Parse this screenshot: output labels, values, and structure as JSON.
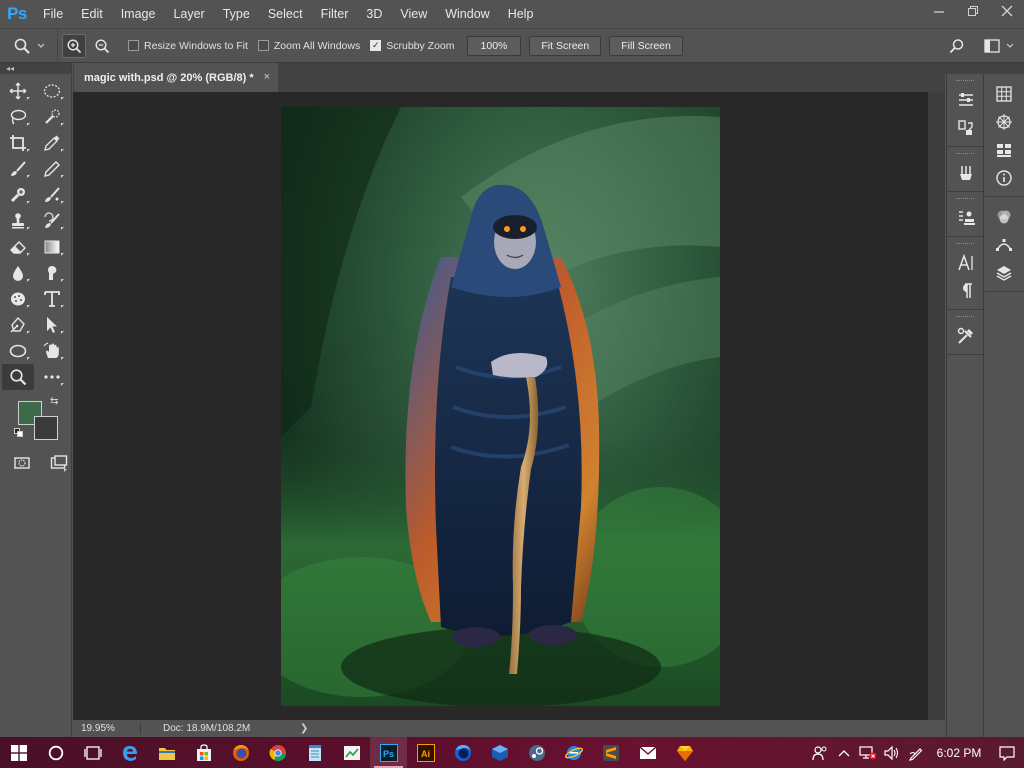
{
  "app": {
    "logo": "Ps",
    "accent": "#31a8ff"
  },
  "menu": [
    "File",
    "Edit",
    "Image",
    "Layer",
    "Type",
    "Select",
    "Filter",
    "3D",
    "View",
    "Window",
    "Help"
  ],
  "window_controls": {
    "minimize": "minimize-icon",
    "restore": "restore-icon",
    "close": "close-icon"
  },
  "options": {
    "resize_windows": {
      "label": "Resize Windows to Fit",
      "checked": false
    },
    "zoom_all": {
      "label": "Zoom All Windows",
      "checked": false
    },
    "scrubby_zoom": {
      "label": "Scrubby Zoom",
      "checked": true
    },
    "btn_100": "100%",
    "btn_fit": "Fit Screen",
    "btn_fill": "Fill Screen"
  },
  "toolbar": {
    "collapse_glyph": "◂◂",
    "tools": [
      [
        "move-tool",
        "marquee-ellipse-tool"
      ],
      [
        "lasso-tool",
        "quick-selection-tool"
      ],
      [
        "crop-tool",
        "eyedropper-tool"
      ],
      [
        "brush-tool",
        "pencil-tool"
      ],
      [
        "healing-brush-tool",
        "mixer-brush-tool"
      ],
      [
        "clone-stamp-tool",
        "history-brush-tool"
      ],
      [
        "eraser-tool",
        "gradient-tool"
      ],
      [
        "blur-tool",
        "smudge-tool"
      ],
      [
        "dodge-tool",
        "type-tool"
      ],
      [
        "pen-tool",
        "path-selection-tool"
      ],
      [
        "ellipse-shape-tool",
        "hand-rotate-tool"
      ],
      [
        "zoom-tool",
        "more-tools"
      ]
    ],
    "fg_color": "#3d6b4a",
    "bg_color": "#3a3a3a"
  },
  "document": {
    "tab_title": "magic with.psd @ 20% (RGB/8) *",
    "close_glyph": "×",
    "zoom": "19.95%",
    "doc_size": "Doc: 18.9M/108.2M",
    "status_arrow": "❯"
  },
  "panels": {
    "col1": [
      "brush-settings-icon",
      "clone-source-icon",
      "brushes-icon",
      "tool-presets-icon",
      "character-icon",
      "paragraph-icon",
      "adjustments-tools-icon"
    ],
    "col2": [
      "histogram-icon",
      "navigator-icon",
      "swatches-icon",
      "info-icon",
      "channels-icon",
      "paths-icon",
      "layers-icon"
    ]
  },
  "taskbar": {
    "apps": [
      "start",
      "cortana",
      "task-view",
      "edge",
      "file-explorer",
      "store",
      "firefox",
      "chrome",
      "notepad",
      "excel-like",
      "photoshop",
      "illustrator",
      "firefox-dev",
      "virtualbox",
      "steam",
      "ie",
      "sublime",
      "mail",
      "sketch"
    ],
    "active_app": "photoshop",
    "time": "6:02 PM"
  }
}
